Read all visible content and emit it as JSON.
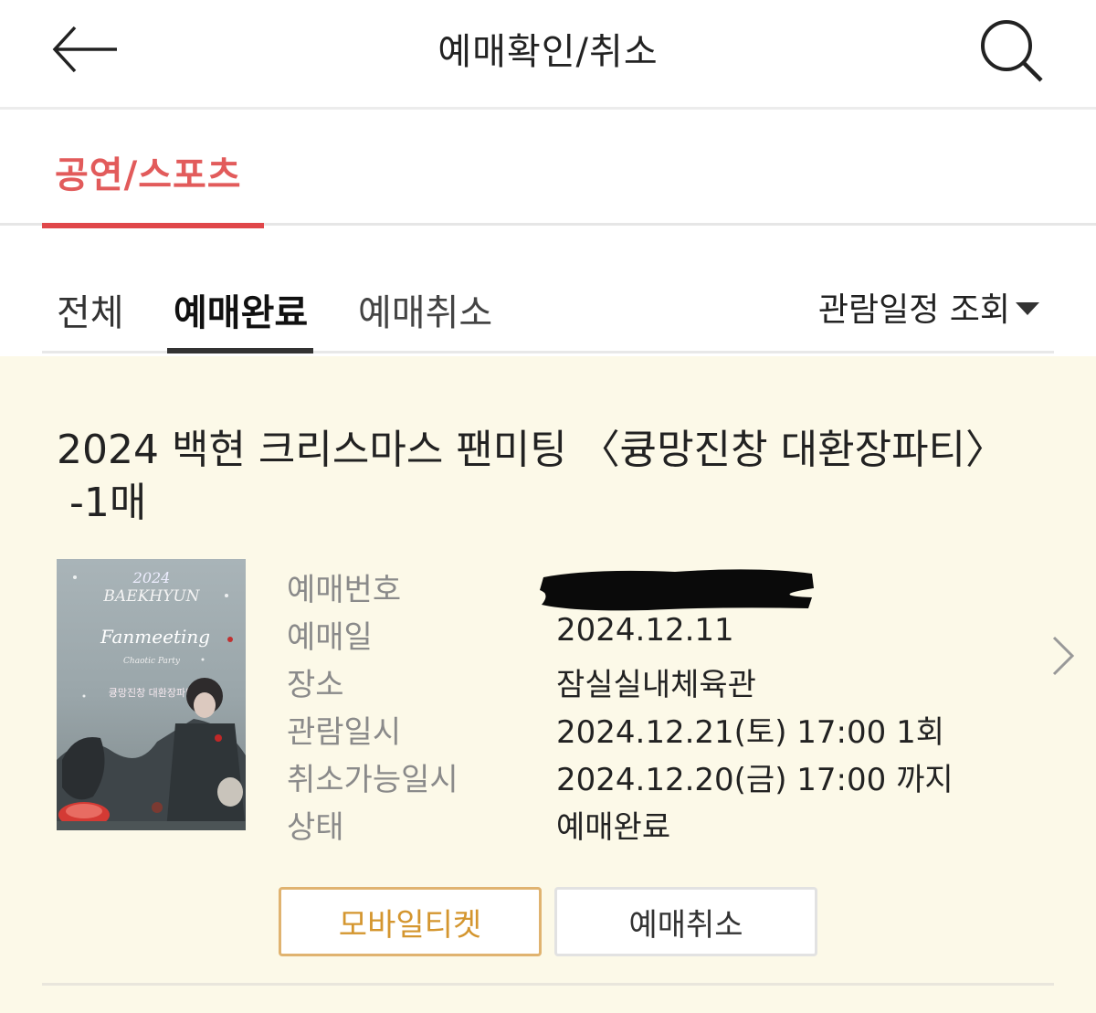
{
  "header": {
    "title": "예매확인/취소",
    "back_icon": "arrow-left-icon",
    "search_icon": "search-icon"
  },
  "category_tabs": [
    {
      "label": "공연/스포츠",
      "active": true
    }
  ],
  "status_tabs": [
    {
      "label": "전체",
      "active": false
    },
    {
      "label": "예매완료",
      "active": true
    },
    {
      "label": "예매취소",
      "active": false
    }
  ],
  "schedule_filter": {
    "label": "관람일정 조회",
    "icon": "caret-down-icon"
  },
  "booking": {
    "title": "2024 백현 크리스마스 팬미팅 〈큥망진창 대환장파티〉",
    "quantity": "-1매",
    "poster": {
      "year": "2024",
      "artist": "BAEKHYUN",
      "event": "Fanmeeting",
      "subtitle": "Chaotic Party",
      "korean": "큥망진창 대환장파티"
    },
    "details": [
      {
        "label": "예매번호",
        "value": "",
        "redacted": true
      },
      {
        "label": "예매일",
        "value": "2024.12.11"
      },
      {
        "label": "장소",
        "value": "잠실실내체육관"
      },
      {
        "label": "관람일시",
        "value": "2024.12.21(토) 17:00 1회"
      },
      {
        "label": "취소가능일시",
        "value": "2024.12.20(금) 17:00 까지"
      },
      {
        "label": "상태",
        "value": "예매완료"
      }
    ],
    "buttons": {
      "mobile_ticket": "모바일티켓",
      "cancel": "예매취소"
    },
    "chevron_icon": "chevron-right-icon"
  },
  "colors": {
    "accent_red": "#e0474a",
    "card_background": "#fcf9e8",
    "mobile_ticket_border": "#e0b370",
    "mobile_ticket_text": "#d4962f"
  }
}
